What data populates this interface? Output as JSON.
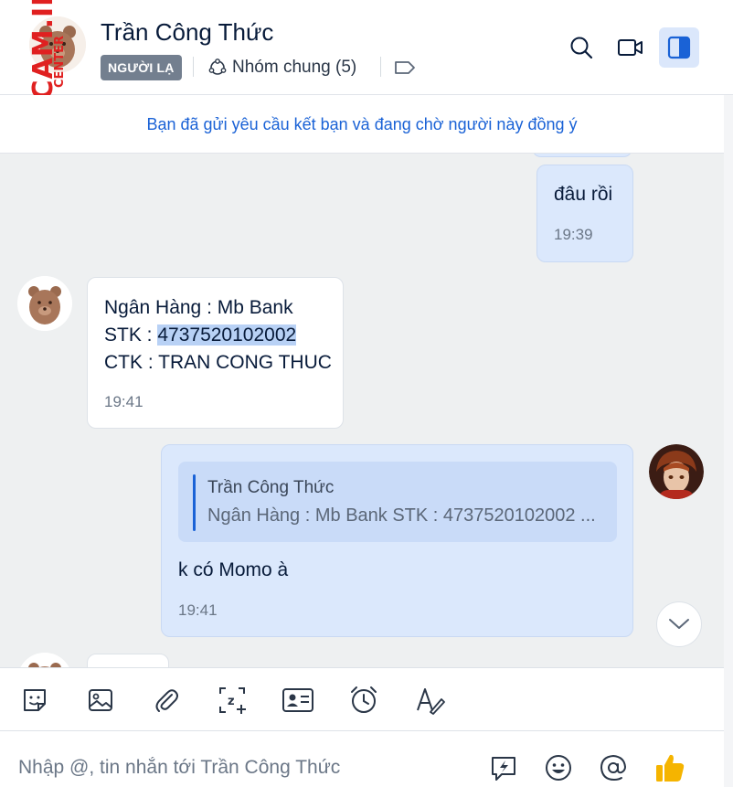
{
  "header": {
    "contact_name": "Trần Công Thức",
    "badge": "NGƯỜI LẠ",
    "common_groups": "Nhóm chung (5)"
  },
  "banner": {
    "text": "Bạn đã gửi yêu cầu kết bạn và đang chờ người này đồng ý"
  },
  "messages": [
    {
      "direction": "outgoing",
      "text": "đâu rồi",
      "time": "19:39"
    },
    {
      "direction": "incoming",
      "line1": "Ngân Hàng : Mb Bank",
      "line2_prefix": "STK : ",
      "line2_account": "4737520102002",
      "line3": "CTK : TRAN CONG THUC",
      "time": "19:41"
    },
    {
      "direction": "outgoing",
      "quote_author": "Trần Công Thức",
      "quote_text": "Ngân Hàng : Mb Bank STK : 4737520102002 ...",
      "text": "k có Momo à",
      "time": "19:41"
    }
  ],
  "composer": {
    "placeholder": "Nhập @, tin nhắn tới Trần Công Thức"
  },
  "watermark": {
    "main": "CHECKSCAM.INFO",
    "sub": "CENTER"
  },
  "icons": {
    "search": "search-icon",
    "video": "video-call-icon",
    "sidebar": "sidebar-toggle-icon",
    "group": "group-icon",
    "tag": "tag-icon",
    "sticker": "sticker-icon",
    "image": "image-icon",
    "attach": "paperclip-icon",
    "screenshot": "screenshot-icon",
    "contact_card": "contact-card-icon",
    "reminder": "alarm-clock-icon",
    "format": "text-format-icon",
    "quick_message": "quick-message-icon",
    "emoji": "emoji-icon",
    "mention": "at-sign-icon",
    "like": "thumbs-up-icon",
    "scroll_down": "chevron-down-icon"
  },
  "colors": {
    "accent": "#1a62d6",
    "outgoing_bubble": "#dbe8fc",
    "incoming_bubble": "#ffffff",
    "badge": "#737f8f",
    "watermark": "#e02020",
    "like": "#f5b400"
  }
}
